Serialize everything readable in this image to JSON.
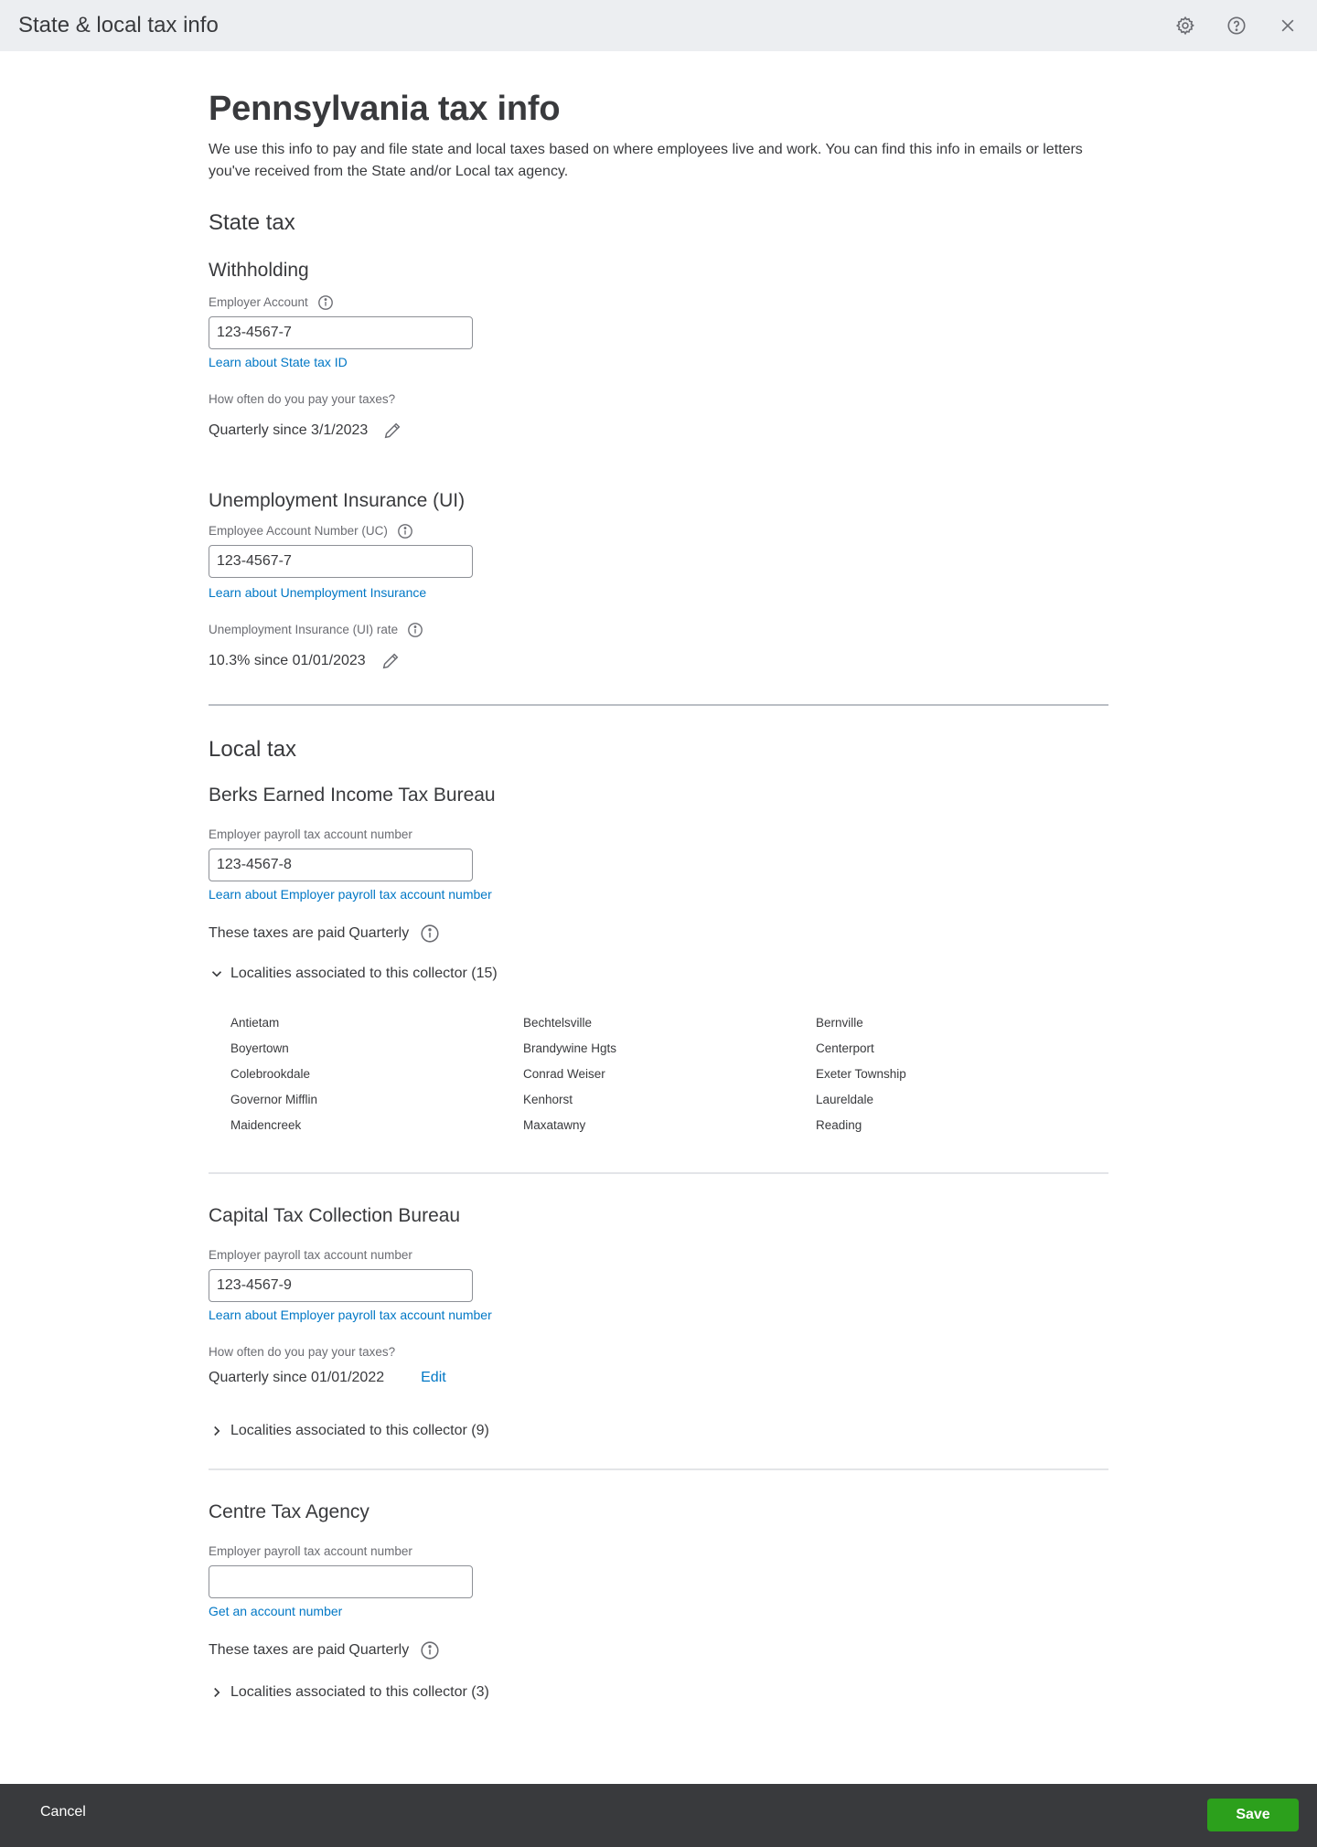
{
  "window": {
    "title": "State & local tax info",
    "icons": [
      "gear-icon",
      "help-icon",
      "close-icon"
    ]
  },
  "page": {
    "title": "Pennsylvania tax info",
    "intro": "We use this info to pay and file state and local taxes based on where employees live and work. You can find this info in emails or letters you've received from the State and/or Local tax agency."
  },
  "state_tax": {
    "heading": "State tax",
    "withholding": {
      "heading": "Withholding",
      "account_label": "Employer Account",
      "account_value": "123-4567-7",
      "learn_link": "Learn about State tax ID",
      "frequency_label": "How often do you pay your taxes?",
      "frequency_value": "Quarterly since 3/1/2023"
    },
    "unemployment": {
      "heading": "Unemployment Insurance (UI)",
      "account_label": "Employee Account Number (UC)",
      "account_value": "123-4567-7",
      "learn_link": "Learn about Unemployment Insurance",
      "rate_label": "Unemployment Insurance (UI) rate",
      "rate_value": "10.3% since 01/01/2023"
    }
  },
  "local_tax": {
    "heading": "Local tax",
    "collectors": [
      {
        "name": "Berks Earned Income Tax Bureau",
        "account_label": "Employer payroll tax account number",
        "account_value": "123-4567-8",
        "learn_link": "Learn about Employer payroll tax account number",
        "paid_prefix": "These taxes are paid",
        "paid_frequency": "Quarterly",
        "localities_toggle": "Localities associated to this collector (15)",
        "expanded": true,
        "localities": [
          "Antietam",
          "Bechtelsville",
          "Bernville",
          "Boyertown",
          "Brandywine Hgts",
          "Centerport",
          "Colebrookdale",
          "Conrad Weiser",
          "Exeter Township",
          "Governor Mifflin",
          "Kenhorst",
          "Laureldale",
          "Maidencreek",
          "Maxatawny",
          "Reading"
        ]
      },
      {
        "name": "Capital Tax Collection Bureau",
        "account_label": "Employer payroll tax account number",
        "account_value": "123-4567-9",
        "learn_link": "Learn about Employer payroll tax account number",
        "frequency_label": "How often do you pay your taxes?",
        "frequency_value": "Quarterly since 01/01/2022",
        "edit_label": "Edit",
        "localities_toggle": "Localities associated to this collector (9)",
        "expanded": false
      },
      {
        "name": "Centre Tax Agency",
        "account_label": "Employer payroll tax account number",
        "account_value": "",
        "learn_link": "Get an account number",
        "paid_prefix": "These taxes are paid",
        "paid_frequency": "Quarterly",
        "localities_toggle": "Localities associated to this collector (3)",
        "expanded": false
      }
    ]
  },
  "footer": {
    "cancel_label": "Cancel",
    "save_label": "Save"
  },
  "colors": {
    "link": "#0077c5",
    "save": "#2ca01c",
    "footer_bg": "#393a3d",
    "topbar_bg": "#eceef1"
  }
}
